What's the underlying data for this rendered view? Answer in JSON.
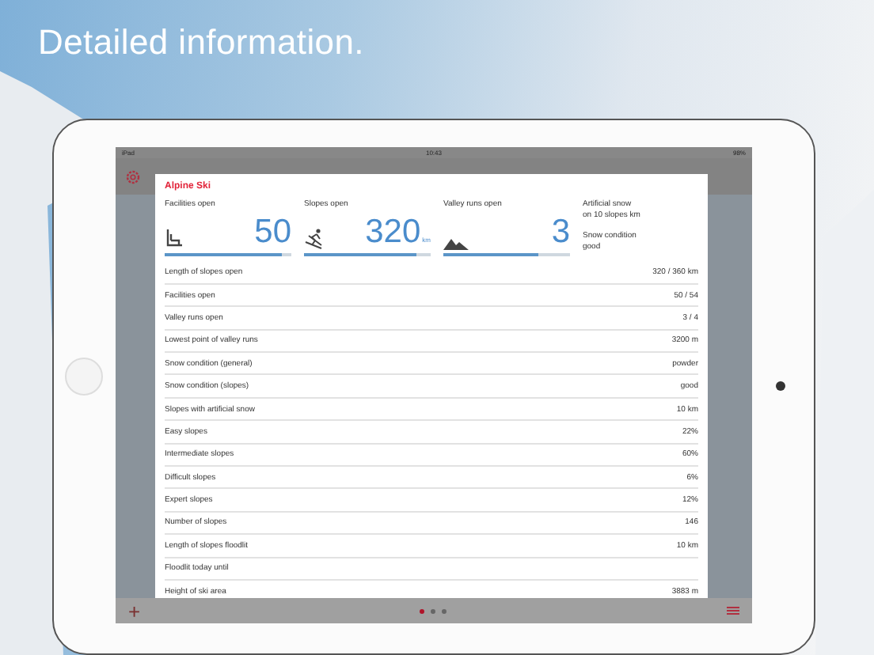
{
  "headline": "Detailed information.",
  "status_bar": {
    "device": "iPad",
    "time": "10:43",
    "battery": "98%"
  },
  "card": {
    "title": "Alpine Ski",
    "stats": [
      {
        "kind": "lift",
        "label": "Facilities open",
        "value": "50",
        "level": 0.93
      },
      {
        "kind": "skier",
        "label": "Slopes open",
        "value": "320",
        "unit": "km",
        "level": 0.89
      },
      {
        "kind": "mountain",
        "label": "Valley runs open",
        "value": "3",
        "level": 0.75
      }
    ],
    "notes": [
      {
        "title": "Artificial snow",
        "detail": "on 10 slopes km"
      },
      {
        "title": "Snow condition",
        "detail": "good"
      }
    ],
    "rows": [
      {
        "label": "Length of slopes open",
        "value": "320 / 360 km"
      },
      {
        "label": "Facilities open",
        "value": "50 / 54"
      },
      {
        "label": "Valley runs open",
        "value": "3 / 4"
      },
      {
        "label": "Lowest point of valley runs",
        "value": "3200 m"
      },
      {
        "label": "Snow condition (general)",
        "value": "powder"
      },
      {
        "label": "Snow condition (slopes)",
        "value": "good"
      },
      {
        "label": "Slopes with artificial snow",
        "value": "10 km"
      },
      {
        "label": "Easy slopes",
        "value": "22%"
      },
      {
        "label": "Intermediate slopes",
        "value": "60%"
      },
      {
        "label": "Difficult slopes",
        "value": "6%"
      },
      {
        "label": "Expert slopes",
        "value": "12%"
      },
      {
        "label": "Number of slopes",
        "value": "146"
      },
      {
        "label": "Length of slopes floodlit",
        "value": "10 km"
      },
      {
        "label": "Floodlit today until"
      },
      {
        "label": "Height of ski area",
        "value": "3883 m"
      }
    ]
  },
  "toolbar": {
    "add": "+"
  },
  "pager": [
    {
      "selected": true
    },
    {
      "selected": false
    },
    {
      "selected": false
    }
  ]
}
